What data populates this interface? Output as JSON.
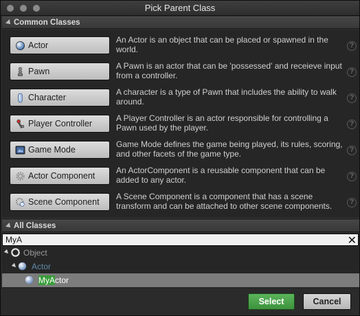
{
  "window": {
    "title": "Pick Parent Class"
  },
  "common": {
    "header": "Common Classes",
    "items": [
      {
        "label": "Actor",
        "icon": "actor-sphere-icon",
        "desc": "An Actor is an object that can be placed or spawned in the world."
      },
      {
        "label": "Pawn",
        "icon": "pawn-figure-icon",
        "desc": "A Pawn is an actor that can be 'possessed' and receieve input from a controller."
      },
      {
        "label": "Character",
        "icon": "character-capsule-icon",
        "desc": "A character is a type of Pawn that includes the ability to walk around."
      },
      {
        "label": "Player Controller",
        "icon": "player-controller-icon",
        "desc": "A Player Controller is an actor responsible for controlling a Pawn used by the player."
      },
      {
        "label": "Game Mode",
        "icon": "game-mode-icon",
        "desc": "Game Mode defines the game being played, its rules, scoring, and other facets of the game type."
      },
      {
        "label": "Actor Component",
        "icon": "actor-component-icon",
        "desc": "An ActorComponent is a reusable component that can be added to any actor."
      },
      {
        "label": "Scene Component",
        "icon": "scene-component-icon",
        "desc": "A Scene Component is a component that has a scene transform and can be attached to other scene components."
      }
    ],
    "help_glyph": "?"
  },
  "all": {
    "header": "All Classes",
    "search": {
      "value": "MyA",
      "clear_glyph": "✕"
    },
    "tree": [
      {
        "label": "Object",
        "level": 0,
        "selected": false
      },
      {
        "label": "Actor",
        "level": 1,
        "selected": false
      },
      {
        "label_match": "MyA",
        "label_rest": "ctor",
        "level": 2,
        "selected": true
      }
    ]
  },
  "footer": {
    "select_label": "Select",
    "cancel_label": "Cancel"
  },
  "colors": {
    "accent_green": "#3d933d",
    "highlight_match": "#3a9d3a",
    "selected_row": "#7c7c7c"
  }
}
